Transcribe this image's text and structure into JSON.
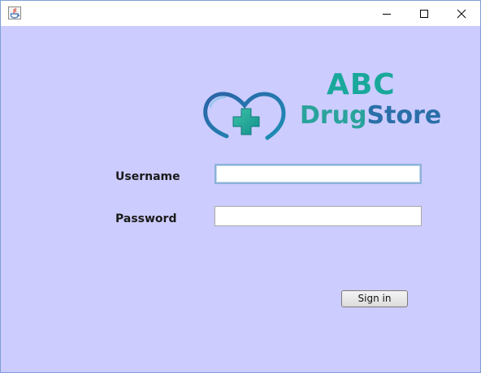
{
  "window": {
    "title": "",
    "controls": [
      "minimize-icon",
      "maximize-icon",
      "close-icon"
    ]
  },
  "logo": {
    "line1": "ABC",
    "line2_part1": "Drug",
    "line2_part2": "Store",
    "mark_icon": "heart-plus-icon",
    "colors": {
      "teal": "#1aa89b",
      "blue": "#2a6fa8"
    }
  },
  "form": {
    "username_label": "Username",
    "username_value": "",
    "password_label": "Password",
    "password_value": "",
    "signin_label": "Sign in"
  },
  "colors": {
    "background": "#ccccff",
    "titlebar": "#ffffff"
  }
}
